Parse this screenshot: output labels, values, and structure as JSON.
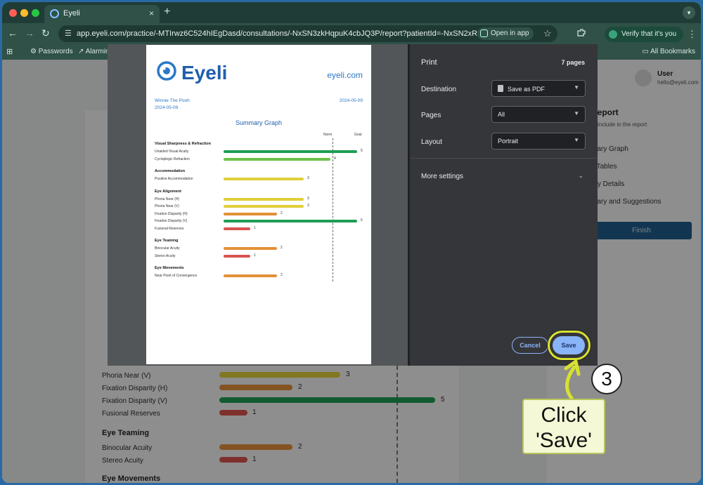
{
  "browser": {
    "tab_title": "Eyeli",
    "tab_close": "×",
    "new_tab": "+",
    "url": "app.eyeli.com/practice/-MTIrwz6C524hIEgDasd/consultations/-NxSN3zkHqpuK4cbJQ3P/report?patientId=-NxSN2xR8u...",
    "open_in_app": "Open in app",
    "verify_label": "Verify that it's you",
    "bookmarks": [
      "Passwords",
      "Alarmin"
    ],
    "all_bookmarks": "All Bookmarks",
    "colors": {
      "tabstrip": "#1f3d36",
      "toolbar": "#2f5147"
    }
  },
  "background": {
    "user_name": "User",
    "user_email": "hello@eyeli.com",
    "report_title": "Report",
    "report_sub": "to include in the report",
    "side_items": [
      "mary Graph",
      "s Tables",
      "ory Details",
      "mary and Suggestions"
    ],
    "finish": "Finish",
    "left_fragments": [
      "W",
      "20",
      "V",
      "U",
      "C",
      "A",
      "Po",
      "E",
      "Ph"
    ],
    "section_eye_teaming": "Eye Teaming",
    "section_eye_movements": "Eye Movements",
    "rows": [
      {
        "label": "Phoria Near (V)",
        "value": "3",
        "color": "#e0cf3a"
      },
      {
        "label": "Fixation Disparity (H)",
        "value": "2",
        "color": "#e3903a"
      },
      {
        "label": "Fixation Disparity (V)",
        "value": "5",
        "color": "#1f9e55"
      },
      {
        "label": "Fusional Reserves",
        "value": "1",
        "color": "#d9534f"
      }
    ],
    "teaming_rows": [
      {
        "label": "Binocular Acuity",
        "value": "2",
        "color": "#e3903a"
      },
      {
        "label": "Stereo Acuity",
        "value": "1",
        "color": "#d9534f"
      }
    ]
  },
  "print_dialog": {
    "title": "Print",
    "pages_count": "7 pages",
    "destination_label": "Destination",
    "destination_value": "Save as PDF",
    "pages_label": "Pages",
    "pages_value": "All",
    "layout_label": "Layout",
    "layout_value": "Portrait",
    "more_settings": "More settings",
    "cancel": "Cancel",
    "save": "Save"
  },
  "preview": {
    "logo_text": "Eyeli",
    "site": "eyeli.com",
    "patient": "Winnie The Pooh",
    "date1": "2024-05-09",
    "date2": "2024-05-09",
    "graph_title": "Summary Graph",
    "norm": "Norm",
    "goal": "Goal",
    "sections": [
      {
        "title": "Visual Sharpness & Refraction",
        "rows": [
          {
            "label": "Unaided Visual Acuity",
            "value": 5,
            "color": "#1f9e55"
          },
          {
            "label": "Cycloplegic Refraction",
            "value": 4,
            "color": "#6cc24a"
          }
        ]
      },
      {
        "title": "Accommodation",
        "rows": [
          {
            "label": "Positive Accommodation",
            "value": 3,
            "color": "#e0cf3a"
          }
        ]
      },
      {
        "title": "Eye Alignment",
        "rows": [
          {
            "label": "Phoria Near (H)",
            "value": 3,
            "color": "#e0cf3a"
          },
          {
            "label": "Phoria Near (V)",
            "value": 3,
            "color": "#e0cf3a"
          },
          {
            "label": "Fixation Disparity (H)",
            "value": 2,
            "color": "#e3903a"
          },
          {
            "label": "Fixation Disparity (V)",
            "value": 5,
            "color": "#1f9e55"
          },
          {
            "label": "Fusional Reserves",
            "value": 1,
            "color": "#d9534f"
          }
        ]
      },
      {
        "title": "Eye Teaming",
        "rows": [
          {
            "label": "Binocular Acuity",
            "value": 2,
            "color": "#e3903a"
          },
          {
            "label": "Stereo Acuity",
            "value": 1,
            "color": "#d9534f"
          }
        ]
      },
      {
        "title": "Eye Movements",
        "rows": [
          {
            "label": "Near Point of Convergence",
            "value": 2,
            "color": "#e3903a"
          }
        ]
      }
    ]
  },
  "annotation": {
    "step": "3",
    "line1": "Click",
    "line2": "'Save'",
    "highlight_color": "#d7e22f"
  }
}
